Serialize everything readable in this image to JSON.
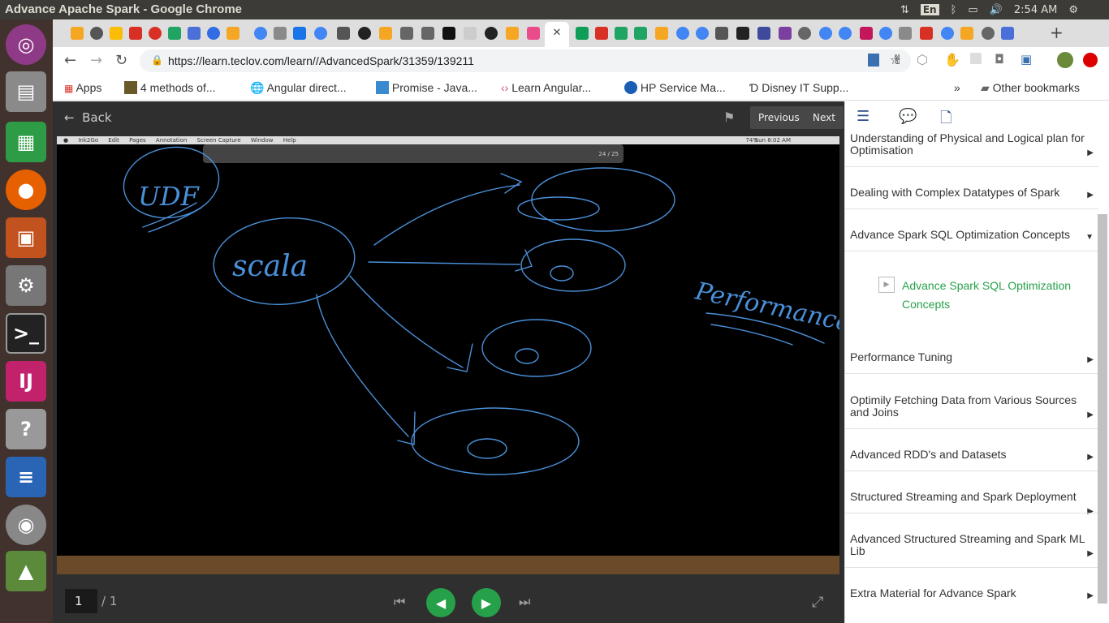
{
  "os": {
    "window_title": "Advance Apache Spark - Google Chrome",
    "language": "En",
    "time": "2:54 AM"
  },
  "browser": {
    "url": "https://learn.teclov.com/learn//AdvancedSpark/31359/139211",
    "bookmarks": [
      {
        "label": "Apps"
      },
      {
        "label": "4 methods of..."
      },
      {
        "label": "Angular direct..."
      },
      {
        "label": "Promise - Java..."
      },
      {
        "label": "Learn Angular..."
      },
      {
        "label": "HP Service Ma..."
      },
      {
        "label": "Disney IT Supp..."
      }
    ],
    "more_bookmarks": "»",
    "other_bookmarks": "Other bookmarks"
  },
  "viewer": {
    "back_label": "Back",
    "previous_label": "Previous",
    "next_label": "Next",
    "page_current": "1",
    "page_total": "/ 1"
  },
  "slide": {
    "mac_menu": [
      "Ink2Go",
      "Edit",
      "Pages",
      "Annotation",
      "Screen Capture",
      "Window",
      "Help"
    ],
    "mac_status": "Sun 8:02 AM",
    "mac_battery": "74%",
    "ink_page": "24 / 25",
    "ink_color": "#4a90d9",
    "handwriting": {
      "udf": "UDF",
      "scala": "scala",
      "performance": "Performance"
    }
  },
  "sidebar": {
    "items": [
      {
        "label": "Understanding of Physical and Logical plan for Optimisation"
      },
      {
        "label": "Dealing with Complex Datatypes of Spark"
      },
      {
        "label": "Advance Spark SQL Optimization Concepts",
        "expanded": true
      },
      {
        "label": "Advance Spark SQL Optimization Concepts",
        "sub": true,
        "active": true
      },
      {
        "label": "Performance Tuning"
      },
      {
        "label": "Optimily Fetching Data from Various Sources and Joins"
      },
      {
        "label": "Advanced RDD's and Datasets"
      },
      {
        "label": "Structured Streaming and Spark Deployment"
      },
      {
        "label": "Advanced Structured Streaming and Spark ML Lib"
      },
      {
        "label": "Extra Material for Advance Spark"
      }
    ],
    "active_color": "#27a04a"
  }
}
